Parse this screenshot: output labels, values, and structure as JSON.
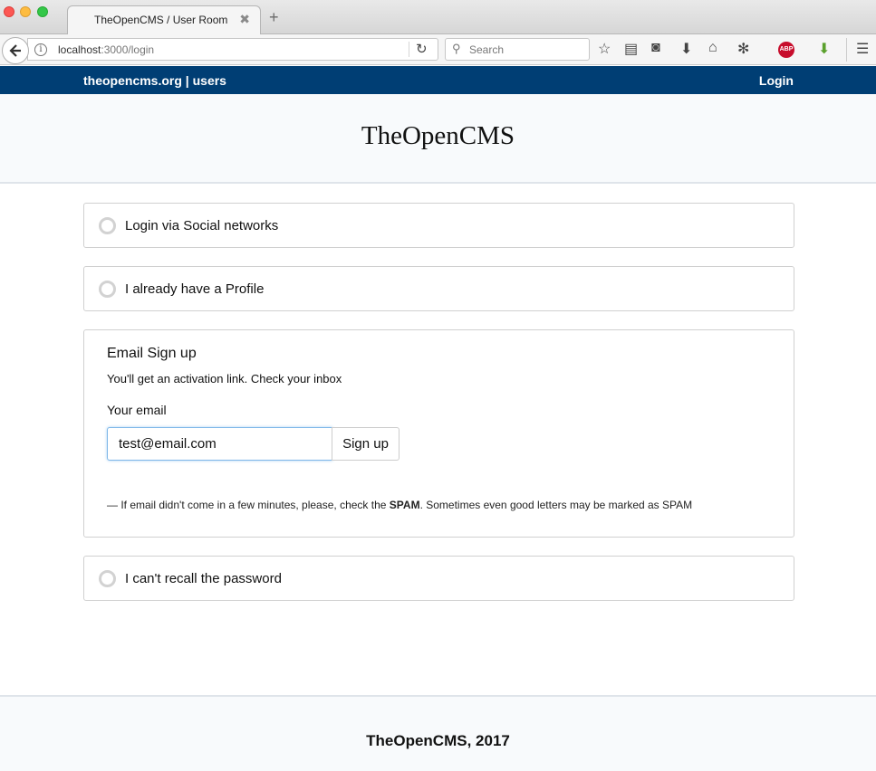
{
  "browser": {
    "tab_title": "TheOpenCMS / User Room",
    "tab_close": "✖",
    "new_tab": "+",
    "url_host": "localhost",
    "url_path": ":3000/login",
    "search_placeholder": "Search"
  },
  "site_nav": {
    "brand": "theopencms.org | users",
    "login": "Login"
  },
  "header": {
    "title": "TheOpenCMS"
  },
  "options": {
    "social": "Login via Social networks",
    "profile": "I already have a Profile",
    "recall": "I can't recall the password"
  },
  "signup": {
    "title": "Email Sign up",
    "subtitle": "You'll get an activation link. Check your inbox",
    "email_label": "Your email",
    "email_value": "test@email.com",
    "button": "Sign up",
    "note_prefix": "— If email didn't come in a few minutes, please, check the ",
    "note_bold": "SPAM",
    "note_suffix": ". Sometimes even good letters may be marked as SPAM"
  },
  "footer": {
    "text": "TheOpenCMS, 2017"
  },
  "colors": {
    "nav_bg": "#003e74",
    "input_focus": "#7fb7e8"
  }
}
